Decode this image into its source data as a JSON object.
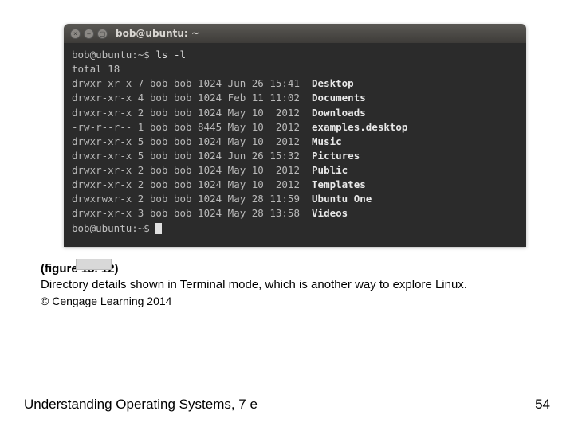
{
  "window": {
    "title": "bob@ubuntu: ~",
    "close_icon": "×",
    "min_icon": "–",
    "max_icon": "▢"
  },
  "terminal": {
    "prompt": "bob@ubuntu:~$",
    "command": "ls -l",
    "total_label": "total",
    "total_value": "18",
    "rows": [
      {
        "perm": "drwxr-xr-x",
        "links": "7",
        "owner": "bob",
        "group": "bob",
        "size": "1024",
        "month": "Jun",
        "day": "26",
        "time": "15:41",
        "name": "Desktop"
      },
      {
        "perm": "drwxr-xr-x",
        "links": "4",
        "owner": "bob",
        "group": "bob",
        "size": "1024",
        "month": "Feb",
        "day": "11",
        "time": "11:02",
        "name": "Documents"
      },
      {
        "perm": "drwxr-xr-x",
        "links": "2",
        "owner": "bob",
        "group": "bob",
        "size": "1024",
        "month": "May",
        "day": "10",
        "time": " 2012",
        "name": "Downloads"
      },
      {
        "perm": "-rw-r--r--",
        "links": "1",
        "owner": "bob",
        "group": "bob",
        "size": "8445",
        "month": "May",
        "day": "10",
        "time": " 2012",
        "name": "examples.desktop"
      },
      {
        "perm": "drwxr-xr-x",
        "links": "5",
        "owner": "bob",
        "group": "bob",
        "size": "1024",
        "month": "May",
        "day": "10",
        "time": " 2012",
        "name": "Music"
      },
      {
        "perm": "drwxr-xr-x",
        "links": "5",
        "owner": "bob",
        "group": "bob",
        "size": "1024",
        "month": "Jun",
        "day": "26",
        "time": "15:32",
        "name": "Pictures"
      },
      {
        "perm": "drwxr-xr-x",
        "links": "2",
        "owner": "bob",
        "group": "bob",
        "size": "1024",
        "month": "May",
        "day": "10",
        "time": " 2012",
        "name": "Public"
      },
      {
        "perm": "drwxr-xr-x",
        "links": "2",
        "owner": "bob",
        "group": "bob",
        "size": "1024",
        "month": "May",
        "day": "10",
        "time": " 2012",
        "name": "Templates"
      },
      {
        "perm": "drwxrwxr-x",
        "links": "2",
        "owner": "bob",
        "group": "bob",
        "size": "1024",
        "month": "May",
        "day": "28",
        "time": "11:59",
        "name": "Ubuntu One"
      },
      {
        "perm": "drwxr-xr-x",
        "links": "3",
        "owner": "bob",
        "group": "bob",
        "size": "1024",
        "month": "May",
        "day": "28",
        "time": "13:58",
        "name": "Videos"
      }
    ]
  },
  "caption": {
    "figure_label": "(figure 15. 12)",
    "text": "Directory details shown in Terminal mode, which is another way to explore Linux."
  },
  "copyright": "© Cengage Learning 2014",
  "footer": {
    "book_title": "Understanding Operating Systems, 7 e",
    "page_number": "54"
  }
}
